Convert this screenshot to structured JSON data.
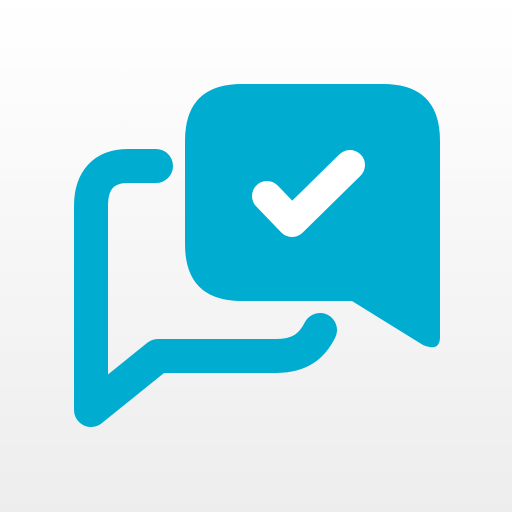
{
  "icon": {
    "name": "chat-bubbles-checkmark-icon",
    "colors": {
      "accent": "#00acd0",
      "check": "#ffffff",
      "background_top": "#ffffff",
      "background_bottom": "#eeeded"
    }
  }
}
